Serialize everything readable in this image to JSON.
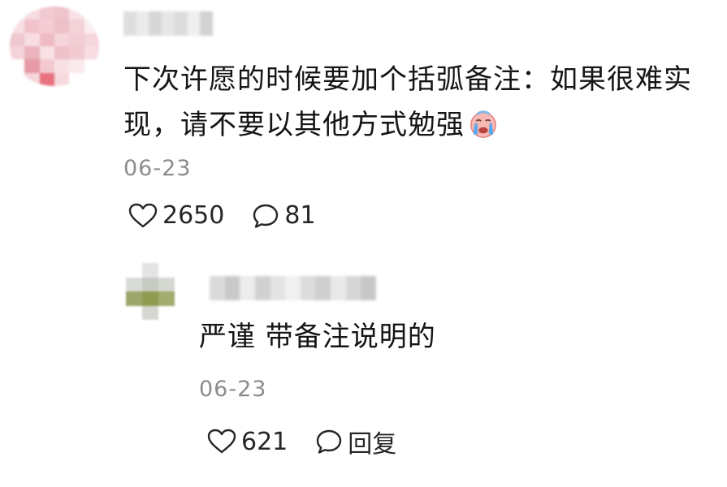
{
  "comment": {
    "text": "下次许愿的时候要加个括弧备注：如果很难实现，请不要以其他方式勉强",
    "emoji": "crying-face-icon",
    "date": "06-23",
    "likes": "2650",
    "replies": "81"
  },
  "reply": {
    "text": "严谨 带备注说明的",
    "date": "06-23",
    "likes": "621",
    "reply_label": "回复"
  }
}
